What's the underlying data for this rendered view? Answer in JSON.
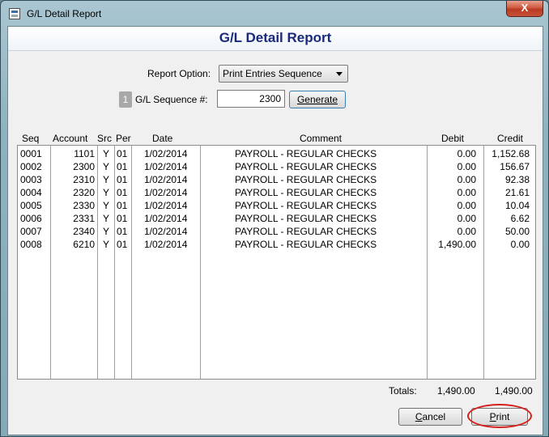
{
  "window": {
    "title": "G/L Detail Report",
    "close_glyph": "X"
  },
  "report": {
    "heading": "G/L Detail Report"
  },
  "options": {
    "report_option_label": "Report Option:",
    "report_option_value": "Print Entries Sequence",
    "sequence_badge": "1",
    "sequence_label": "G/L Sequence #:",
    "sequence_value": "2300",
    "generate_label": "Generate"
  },
  "table": {
    "columns": [
      "Seq",
      "Account",
      "Src",
      "Per",
      "Date",
      "Comment",
      "Debit",
      "Credit"
    ],
    "rows": [
      {
        "seq": "0001",
        "account": "1101",
        "src": "Y",
        "per": "01",
        "date": "1/02/2014",
        "comment": "PAYROLL -  REGULAR CHECKS",
        "debit": "0.00",
        "credit": "1,152.68"
      },
      {
        "seq": "0002",
        "account": "2300",
        "src": "Y",
        "per": "01",
        "date": "1/02/2014",
        "comment": "PAYROLL -  REGULAR CHECKS",
        "debit": "0.00",
        "credit": "156.67"
      },
      {
        "seq": "0003",
        "account": "2310",
        "src": "Y",
        "per": "01",
        "date": "1/02/2014",
        "comment": "PAYROLL -  REGULAR CHECKS",
        "debit": "0.00",
        "credit": "92.38"
      },
      {
        "seq": "0004",
        "account": "2320",
        "src": "Y",
        "per": "01",
        "date": "1/02/2014",
        "comment": "PAYROLL -  REGULAR CHECKS",
        "debit": "0.00",
        "credit": "21.61"
      },
      {
        "seq": "0005",
        "account": "2330",
        "src": "Y",
        "per": "01",
        "date": "1/02/2014",
        "comment": "PAYROLL -  REGULAR CHECKS",
        "debit": "0.00",
        "credit": "10.04"
      },
      {
        "seq": "0006",
        "account": "2331",
        "src": "Y",
        "per": "01",
        "date": "1/02/2014",
        "comment": "PAYROLL -  REGULAR CHECKS",
        "debit": "0.00",
        "credit": "6.62"
      },
      {
        "seq": "0007",
        "account": "2340",
        "src": "Y",
        "per": "01",
        "date": "1/02/2014",
        "comment": "PAYROLL -  REGULAR CHECKS",
        "debit": "0.00",
        "credit": "50.00"
      },
      {
        "seq": "0008",
        "account": "6210",
        "src": "Y",
        "per": "01",
        "date": "1/02/2014",
        "comment": "PAYROLL -  REGULAR CHECKS",
        "debit": "1,490.00",
        "credit": "0.00"
      }
    ]
  },
  "totals": {
    "label": "Totals:",
    "debit": "1,490.00",
    "credit": "1,490.00"
  },
  "buttons": {
    "cancel_first": "C",
    "cancel_rest": "ancel",
    "print_first": "P",
    "print_rest": "rint"
  },
  "colors": {
    "title_blue": "#1a2a7a",
    "highlight_red": "#d6201c",
    "close_red": "#c8533a"
  }
}
